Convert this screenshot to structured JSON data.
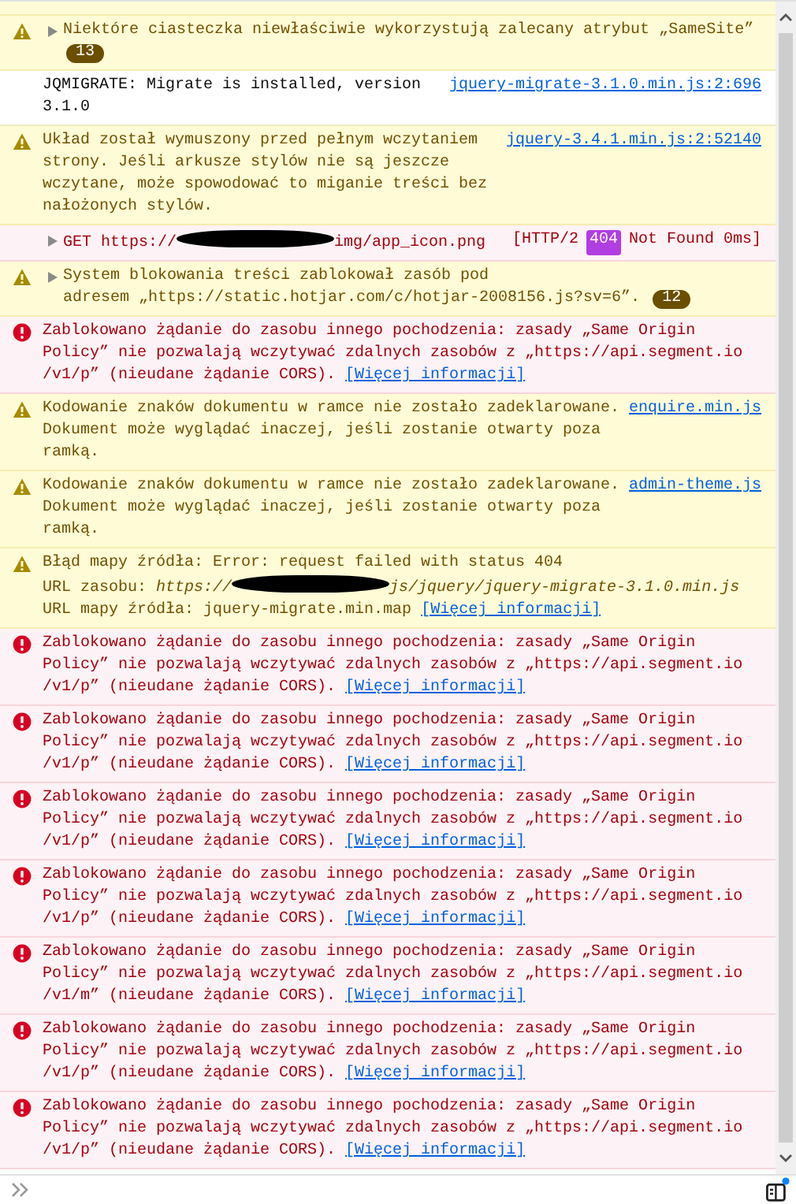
{
  "messages": [
    {
      "kind": "warning",
      "expandable": true,
      "lines": [
        "Niektóre ciasteczka niewłaściwie wykorzystują zalecany atrybut „SameSite”"
      ],
      "count": "13"
    },
    {
      "kind": "log",
      "lines": [
        "JQMIGRATE: Migrate is installed, version",
        "3.1.0"
      ],
      "location": "jquery-migrate-3.1.0.min.js:2:696"
    },
    {
      "kind": "warning",
      "lines": [
        "Układ został wymuszony przed pełnym wczytaniem",
        "strony. Jeśli arkusze stylów nie są jeszcze",
        "wczytane, może spowodować to miganie treści bez",
        "nałożonych stylów."
      ],
      "location": "jquery-3.4.1.min.js:2:52140"
    },
    {
      "kind": "network",
      "expandable": true,
      "lines": [
        [
          {
            "text": "GET https://"
          },
          {
            "redacted": true
          },
          {
            "text": "img/app_icon.png"
          }
        ]
      ],
      "status": {
        "protocol": "[HTTP/2",
        "code": "404",
        "text": "Not Found 0ms]"
      }
    },
    {
      "kind": "warning",
      "expandable": true,
      "lines": [
        "System blokowania treści zablokował zasób pod",
        "adresem „https://static.hotjar.com/c/hotjar-2008156.js?sv=6”."
      ],
      "count": "12"
    },
    {
      "kind": "error",
      "lines": [
        "Zablokowano żądanie do zasobu innego pochodzenia: zasady „Same Origin",
        "Policy” nie pozwalają wczytywać zdalnych zasobów z „https://api.segment.io",
        "/v1/p” (nieudane żądanie CORS)."
      ],
      "link": "[Więcej informacji]"
    },
    {
      "kind": "warning",
      "lines": [
        "Kodowanie znaków dokumentu w ramce nie zostało zadeklarowane.",
        "Dokument może wyglądać inaczej, jeśli zostanie otwarty poza",
        "ramką."
      ],
      "location": "enquire.min.js"
    },
    {
      "kind": "warning",
      "lines": [
        "Kodowanie znaków dokumentu w ramce nie zostało zadeklarowane.",
        "Dokument może wyglądać inaczej, jeśli zostanie otwarty poza",
        "ramką."
      ],
      "location": "admin-theme.js"
    },
    {
      "kind": "warning",
      "lines": [
        "Błąd mapy źródła: Error: request failed with status 404",
        [
          {
            "text": "URL zasobu: "
          },
          {
            "text": "https://",
            "italic": true
          },
          {
            "redacted": true
          },
          {
            "text": "js/jquery/jquery-migrate-3.1.0.min.js",
            "italic": true
          }
        ],
        "URL mapy źródła: jquery-migrate.min.map"
      ],
      "link": "[Więcej informacji]"
    },
    {
      "kind": "error",
      "lines": [
        "Zablokowano żądanie do zasobu innego pochodzenia: zasady „Same Origin",
        "Policy” nie pozwalają wczytywać zdalnych zasobów z „https://api.segment.io",
        "/v1/p” (nieudane żądanie CORS)."
      ],
      "link": "[Więcej informacji]"
    },
    {
      "kind": "error",
      "lines": [
        "Zablokowano żądanie do zasobu innego pochodzenia: zasady „Same Origin",
        "Policy” nie pozwalają wczytywać zdalnych zasobów z „https://api.segment.io",
        "/v1/p” (nieudane żądanie CORS)."
      ],
      "link": "[Więcej informacji]"
    },
    {
      "kind": "error",
      "lines": [
        "Zablokowano żądanie do zasobu innego pochodzenia: zasady „Same Origin",
        "Policy” nie pozwalają wczytywać zdalnych zasobów z „https://api.segment.io",
        "/v1/p” (nieudane żądanie CORS)."
      ],
      "link": "[Więcej informacji]"
    },
    {
      "kind": "error",
      "lines": [
        "Zablokowano żądanie do zasobu innego pochodzenia: zasady „Same Origin",
        "Policy” nie pozwalają wczytywać zdalnych zasobów z „https://api.segment.io",
        "/v1/p” (nieudane żądanie CORS)."
      ],
      "link": "[Więcej informacji]"
    },
    {
      "kind": "error",
      "lines": [
        "Zablokowano żądanie do zasobu innego pochodzenia: zasady „Same Origin",
        "Policy” nie pozwalają wczytywać zdalnych zasobów z „https://api.segment.io",
        "/v1/m” (nieudane żądanie CORS)."
      ],
      "link": "[Więcej informacji]"
    },
    {
      "kind": "error",
      "lines": [
        "Zablokowano żądanie do zasobu innego pochodzenia: zasady „Same Origin",
        "Policy” nie pozwalają wczytywać zdalnych zasobów z „https://api.segment.io",
        "/v1/p” (nieudane żądanie CORS)."
      ],
      "link": "[Więcej informacji]"
    },
    {
      "kind": "error",
      "lines": [
        "Zablokowano żądanie do zasobu innego pochodzenia: zasady „Same Origin",
        "Policy” nie pozwalają wczytywać zdalnych zasobów z „https://api.segment.io",
        "/v1/p” (nieudane żądanie CORS)."
      ],
      "link": "[Więcej informacji]"
    }
  ]
}
